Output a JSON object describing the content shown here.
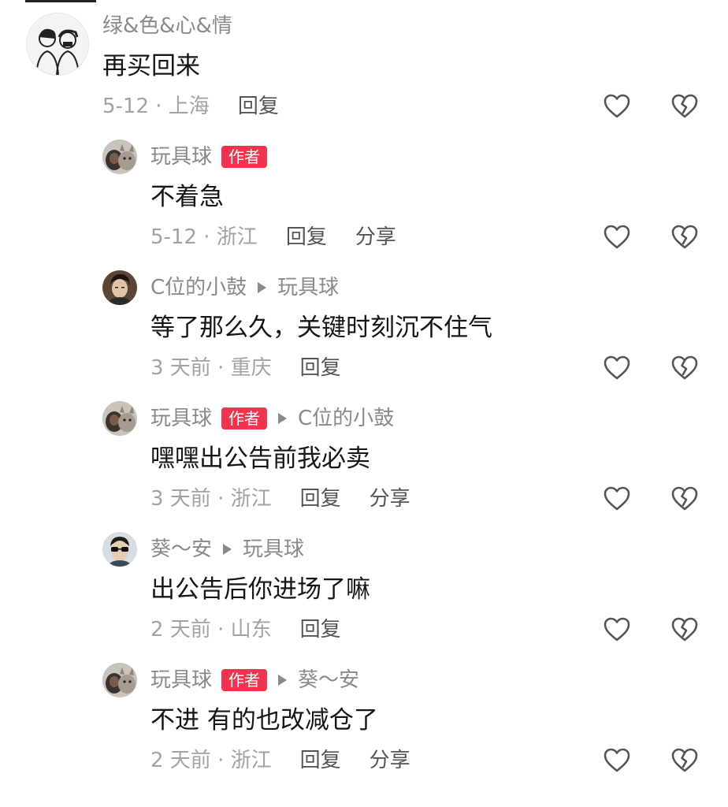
{
  "comments": [
    {
      "username": "绿&色&心&情",
      "author_badge": "",
      "reply_to": "",
      "text": "再买回来",
      "meta": "5-12 · 上海",
      "actions": [
        "回复"
      ],
      "avatar": "sketch-couple-avatar"
    },
    {
      "username": "玩具球",
      "author_badge": "作者",
      "reply_to": "",
      "text": "不着急",
      "meta": "5-12 · 浙江",
      "actions": [
        "回复",
        "分享"
      ],
      "avatar": "dog-cat-avatar"
    },
    {
      "username": "C位的小鼓",
      "author_badge": "",
      "reply_to": "玩具球",
      "text": "等了那么久，关键时刻沉不住气",
      "meta": "3 天前 · 重庆",
      "actions": [
        "回复"
      ],
      "avatar": "man-portrait-avatar"
    },
    {
      "username": "玩具球",
      "author_badge": "作者",
      "reply_to": "C位的小鼓",
      "text": "嘿嘿出公告前我必卖",
      "meta": "3 天前 · 浙江",
      "actions": [
        "回复",
        "分享"
      ],
      "avatar": "dog-cat-avatar"
    },
    {
      "username": "葵～安",
      "author_badge": "",
      "reply_to": "玩具球",
      "text": "出公告后你进场了嘛",
      "meta": "2 天前 · 山东",
      "actions": [
        "回复"
      ],
      "avatar": "sunglasses-avatar"
    },
    {
      "username": "玩具球",
      "author_badge": "作者",
      "reply_to": "葵～安",
      "text": "不进 有的也改减仓了",
      "meta": "2 天前 · 浙江",
      "actions": [
        "回复",
        "分享"
      ],
      "avatar": "dog-cat-avatar"
    }
  ],
  "icons": {
    "like": "heart-outline-icon",
    "dislike": "broken-heart-icon"
  },
  "colors": {
    "author_badge_bg": "#f0334e",
    "username": "#8a8a8a",
    "text": "#161616",
    "meta": "#a3a3a3",
    "action": "#555555"
  }
}
